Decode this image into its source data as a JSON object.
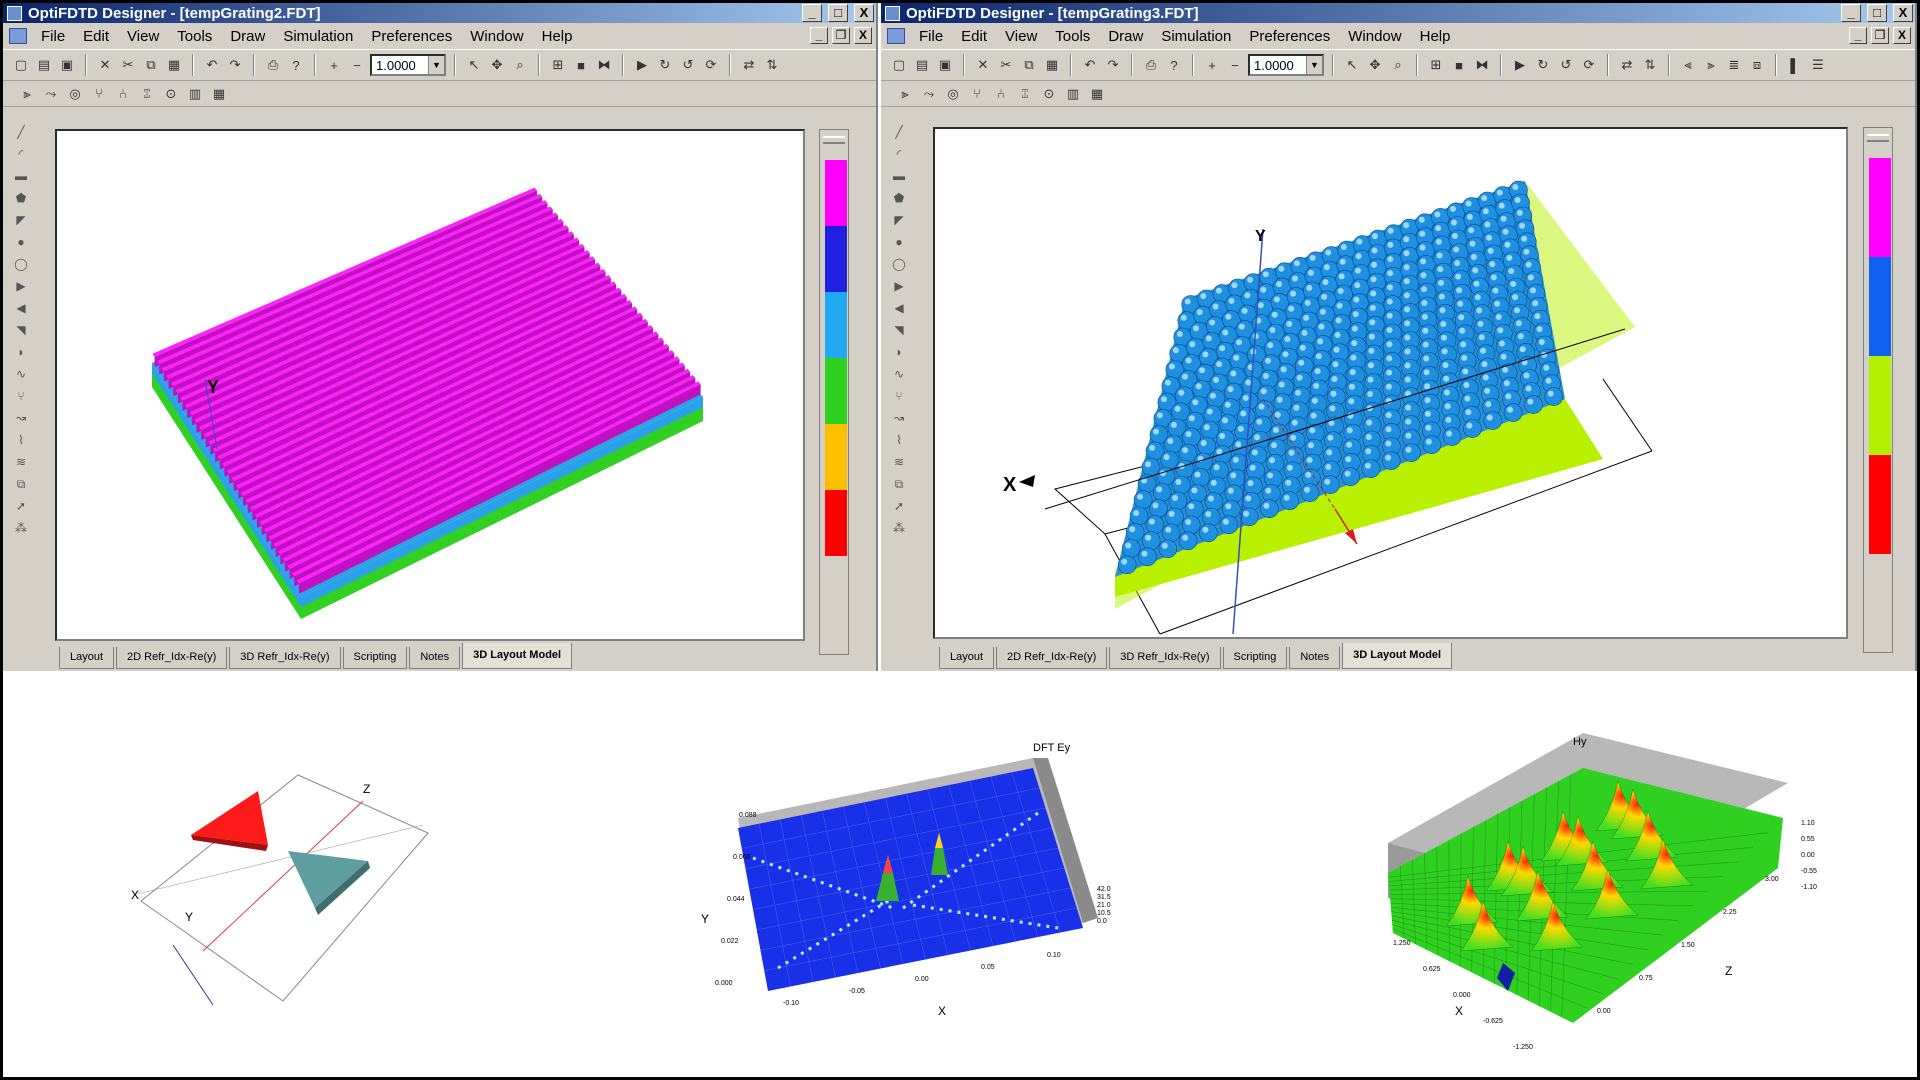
{
  "window_a": {
    "title": "OptiFDTD Designer  - [tempGrating2.FDT]",
    "menus": [
      "File",
      "Edit",
      "View",
      "Tools",
      "Draw",
      "Simulation",
      "Preferences",
      "Window",
      "Help"
    ],
    "zoom_value": "1.0000",
    "tabs": [
      "Layout",
      "2D Refr_Idx-Re(y)",
      "3D Refr_Idx-Re(y)",
      "Scripting",
      "Notes",
      "3D Layout Model"
    ],
    "active_tab": "3D Layout Model",
    "axis_label": "Y",
    "palette_colors": [
      "#ff00ff",
      "#2020e0",
      "#20a8f0",
      "#30d020",
      "#ffc000",
      "#ff0000"
    ]
  },
  "window_b": {
    "title": "OptiFDTD Designer  - [tempGrating3.FDT]",
    "menus": [
      "File",
      "Edit",
      "View",
      "Tools",
      "Draw",
      "Simulation",
      "Preferences",
      "Window",
      "Help"
    ],
    "zoom_value": "1.0000",
    "tabs": [
      "Layout",
      "2D Refr_Idx-Re(y)",
      "3D Refr_Idx-Re(y)",
      "Scripting",
      "Notes",
      "3D Layout Model"
    ],
    "active_tab": "3D Layout Model",
    "axis_x_label": "X",
    "axis_y_label": "Y",
    "palette_colors": [
      "#ff00ff",
      "#1060f0",
      "#b0f000",
      "#ff0000"
    ]
  },
  "title_controls": [
    "_",
    "□",
    "X"
  ],
  "mdi_controls": [
    "_",
    "❐",
    "X"
  ],
  "figure_prisms": {
    "axis_labels": [
      "X",
      "Y",
      "Z"
    ],
    "colors": {
      "left_prism": "#ff1a1a",
      "right_prism": "#5f9ea0"
    }
  },
  "figure_dft": {
    "title": "DFT Ey",
    "x_label": "X",
    "y_label": "Y",
    "x_ticks": [
      "-0.10",
      "-0.05",
      "0.00",
      "0.05",
      "0.10"
    ],
    "y_ticks": [
      "0.000",
      "0.022",
      "0.044",
      "0.066",
      "0.088"
    ],
    "z_ticks": [
      "42.0",
      "31.5",
      "21.0",
      "10.5",
      "0.0"
    ]
  },
  "figure_hy": {
    "title": "Hy",
    "x_label": "X",
    "z_label": "Z",
    "x_ticks": [
      "1.250",
      "0.625",
      "0.000",
      "-0.625",
      "-1.250"
    ],
    "z_ticks": [
      "3.00",
      "2.25",
      "1.50",
      "0.75",
      "0.00"
    ],
    "value_ticks": [
      "1.10",
      "0.55",
      "0.00",
      "-0.55",
      "-1.10"
    ]
  }
}
